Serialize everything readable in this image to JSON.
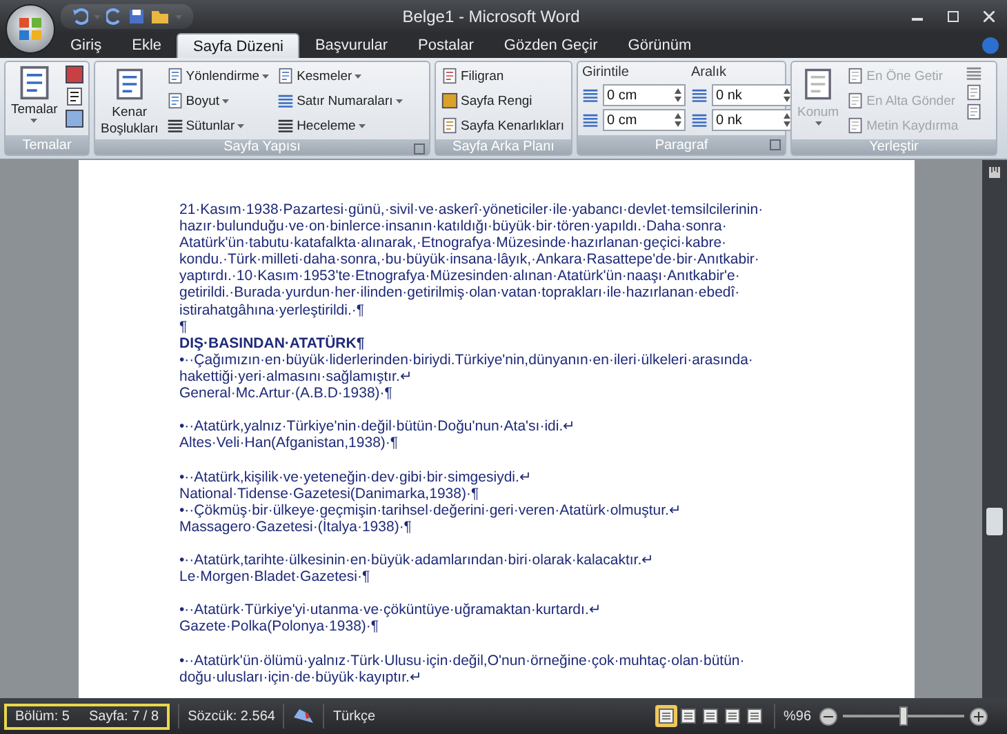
{
  "window": {
    "title": "Belge1 - Microsoft Word"
  },
  "tabs": [
    {
      "label": "Giriş",
      "selected": false
    },
    {
      "label": "Ekle",
      "selected": false
    },
    {
      "label": "Sayfa Düzeni",
      "selected": true
    },
    {
      "label": "Başvurular",
      "selected": false
    },
    {
      "label": "Postalar",
      "selected": false
    },
    {
      "label": "Gözden Geçir",
      "selected": false
    },
    {
      "label": "Görünüm",
      "selected": false
    }
  ],
  "ribbon": {
    "temalar": {
      "title": "Temalar",
      "big": {
        "label": "Temalar"
      }
    },
    "sayfa_yapisi": {
      "title": "Sayfa Yapısı",
      "big": {
        "label_lines": [
          "Kenar",
          "Boşlukları"
        ]
      },
      "items": [
        {
          "label": "Yönlendirme"
        },
        {
          "label": "Boyut"
        },
        {
          "label": "Sütunlar"
        },
        {
          "label": "Kesmeler"
        },
        {
          "label": "Satır Numaraları"
        },
        {
          "label": "Heceleme"
        }
      ]
    },
    "sayfa_arka_plani": {
      "title": "Sayfa Arka Planı",
      "items": [
        {
          "label": "Filigran"
        },
        {
          "label": "Sayfa Rengi"
        },
        {
          "label": "Sayfa Kenarlıkları"
        }
      ]
    },
    "paragraf": {
      "title": "Paragraf",
      "girintile": {
        "heading": "Girintile",
        "fields": [
          {
            "value": "0 cm"
          },
          {
            "value": "0 cm"
          }
        ]
      },
      "aralik": {
        "heading": "Aralık",
        "fields": [
          {
            "value": "0 nk"
          },
          {
            "value": "0 nk"
          }
        ]
      }
    },
    "yerlestir": {
      "title": "Yerleştir",
      "big": {
        "label": "Konum",
        "disabled": true
      },
      "items": [
        {
          "label": "En Öne Getir",
          "disabled": true
        },
        {
          "label": "En Alta Gönder",
          "disabled": true
        },
        {
          "label": "Metin Kaydırma",
          "disabled": true
        }
      ]
    }
  },
  "document": {
    "blocks": [
      {
        "kind": "body",
        "space_after": false,
        "lines": [
          "21·Kasım·1938·Pazartesi·günü,·sivil·ve·askerî·yöneticiler·ile·yabancı·devlet·temsilcilerinin·",
          "hazır·bulunduğu·ve·on·binlerce·insanın·katıldığı·büyük·bir·tören·yapıldı.·Daha·sonra·",
          "Atatürk'ün·tabutu·katafalkta·alınarak,·Etnografya·Müzesinde·hazırlanan·geçici·kabre·",
          "kondu.·Türk·milleti·daha·sonra,·bu·büyük·insana·lâyık,·Ankara·Rasattepe'de·bir·Anıtkabir·",
          "yaptırdı.·10·Kasım·1953'te·Etnografya·Müzesinden·alınan·Atatürk'ün·naaşı·Anıtkabir'e·",
          "getirildi.·Burada·yurdun·her·ilinden·getirilmiş·olan·vatan·toprakları·ile·hazırlanan·ebedî·",
          "istirahatgâhına·yerleştirildi.·¶"
        ]
      },
      {
        "kind": "body",
        "space_after": false,
        "lines": [
          "¶"
        ]
      },
      {
        "kind": "heading",
        "space_after": false,
        "lines": [
          "DIŞ·BASINDAN·ATATÜRK¶"
        ]
      },
      {
        "kind": "body",
        "space_after": true,
        "lines": [
          "•··Çağımızın·en·büyük·liderlerinden·biriydi.Türkiye'nin,dünyanın·en·ileri·ülkeleri·arasında·",
          "hakettiği·yeri·almasını·sağlamıştır.↵",
          "General·Mc.Artur·(A.B.D·1938)·¶"
        ]
      },
      {
        "kind": "body",
        "space_after": true,
        "lines": [
          "•··Atatürk,yalnız·Türkiye'nin·değil·bütün·Doğu'nun·Ata'sı·idi.↵",
          "Altes·Veli·Han(Afganistan,1938)·¶"
        ]
      },
      {
        "kind": "body",
        "space_after": false,
        "lines": [
          "•··Atatürk,kişilik·ve·yeteneğin·dev·gibi·bir·simgesiydi.↵",
          "National·Tidense·Gazetesi(Danimarka,1938)·¶"
        ]
      },
      {
        "kind": "body",
        "space_after": true,
        "lines": [
          "•··Çökmüş·bir·ülkeye·geçmişin·tarihsel·değerini·geri·veren·Atatürk·olmuştur.↵",
          "Massagero·Gazetesi·(İtalya·1938)·¶"
        ]
      },
      {
        "kind": "body",
        "space_after": true,
        "lines": [
          "•··Atatürk,tarihte·ülkesinin·en·büyük·adamlarından·biri·olarak·kalacaktır.↵",
          "Le·Morgen·Bladet·Gazetesi·¶"
        ]
      },
      {
        "kind": "body",
        "space_after": true,
        "lines": [
          "•··Atatürk·Türkiye'yi·utanma·ve·çöküntüye·uğramaktan·kurtardı.↵",
          "Gazete·Polka(Polonya·1938)·¶"
        ]
      },
      {
        "kind": "body",
        "space_after": false,
        "lines": [
          "•··Atatürk'ün·ölümü·yalnız·Türk·Ulusu·için·değil,O'nun·örneğine·çok·muhtaç·olan·bütün·",
          "doğu·ulusları·için·de·büyük·kayıptır.↵"
        ]
      }
    ]
  },
  "status_bar": {
    "items": [
      {
        "label": "Bölüm: 5",
        "highlighted": true
      },
      {
        "label": "Sayfa: 7 / 8",
        "highlighted": true
      },
      {
        "label": "Sözcük: 2.564",
        "highlighted": false
      }
    ],
    "language": "Türkçe",
    "views": [
      {
        "selected": true
      },
      {
        "selected": false
      },
      {
        "selected": false
      },
      {
        "selected": false
      },
      {
        "selected": false
      }
    ],
    "zoom": {
      "label": "%96",
      "level": 0.5
    }
  }
}
